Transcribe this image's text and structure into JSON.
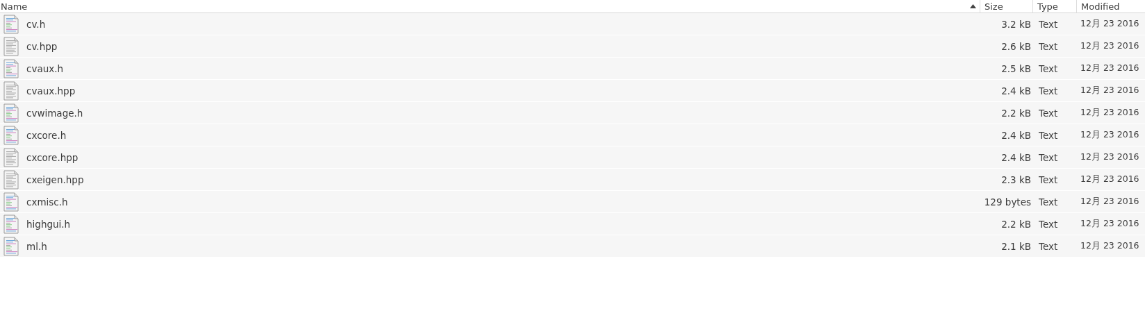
{
  "columns": [
    {
      "label": "Name",
      "sorted": true
    },
    {
      "label": "Size",
      "sorted": false
    },
    {
      "label": "Type",
      "sorted": false
    },
    {
      "label": "Modified",
      "sorted": false
    }
  ],
  "files": [
    {
      "name": "cv.h",
      "size": "3.2 kB",
      "type": "Text",
      "modified": "12月 23 2016",
      "kind": "code"
    },
    {
      "name": "cv.hpp",
      "size": "2.6 kB",
      "type": "Text",
      "modified": "12月 23 2016",
      "kind": "plain"
    },
    {
      "name": "cvaux.h",
      "size": "2.5 kB",
      "type": "Text",
      "modified": "12月 23 2016",
      "kind": "code"
    },
    {
      "name": "cvaux.hpp",
      "size": "2.4 kB",
      "type": "Text",
      "modified": "12月 23 2016",
      "kind": "plain"
    },
    {
      "name": "cvwimage.h",
      "size": "2.2 kB",
      "type": "Text",
      "modified": "12月 23 2016",
      "kind": "code"
    },
    {
      "name": "cxcore.h",
      "size": "2.4 kB",
      "type": "Text",
      "modified": "12月 23 2016",
      "kind": "code"
    },
    {
      "name": "cxcore.hpp",
      "size": "2.4 kB",
      "type": "Text",
      "modified": "12月 23 2016",
      "kind": "plain"
    },
    {
      "name": "cxeigen.hpp",
      "size": "2.3 kB",
      "type": "Text",
      "modified": "12月 23 2016",
      "kind": "plain"
    },
    {
      "name": "cxmisc.h",
      "size": "129 bytes",
      "type": "Text",
      "modified": "12月 23 2016",
      "kind": "code"
    },
    {
      "name": "highgui.h",
      "size": "2.2 kB",
      "type": "Text",
      "modified": "12月 23 2016",
      "kind": "code"
    },
    {
      "name": "ml.h",
      "size": "2.1 kB",
      "type": "Text",
      "modified": "12月 23 2016",
      "kind": "code"
    }
  ]
}
